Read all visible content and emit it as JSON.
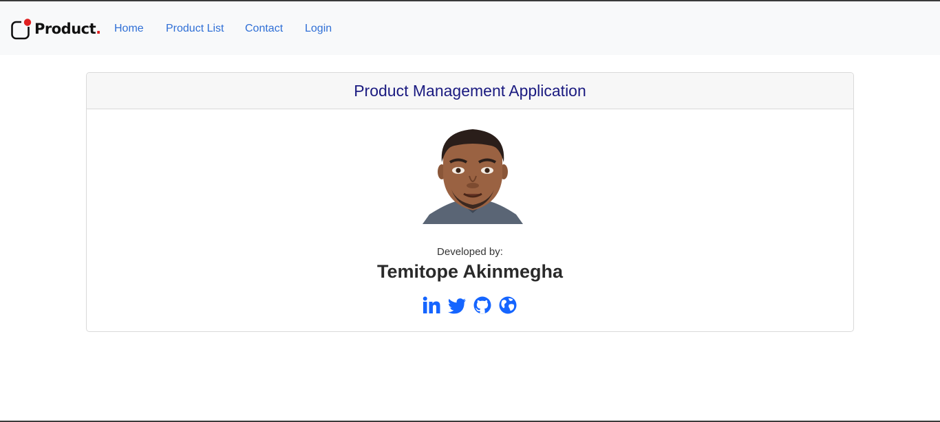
{
  "brand": {
    "name": "Product",
    "dot": "."
  },
  "nav": {
    "items": [
      {
        "label": "Home"
      },
      {
        "label": "Product List"
      },
      {
        "label": "Contact"
      },
      {
        "label": "Login"
      }
    ]
  },
  "card": {
    "title": "Product Management Application",
    "developed_by_label": "Developed by:",
    "developer_name": "Temitope Akinmegha"
  },
  "socials": [
    {
      "icon": "linkedin-icon"
    },
    {
      "icon": "twitter-icon"
    },
    {
      "icon": "github-icon"
    },
    {
      "icon": "globe-icon"
    }
  ],
  "colors": {
    "nav_link": "#2f6fd6",
    "title": "#1a1a80",
    "social": "#1565ff",
    "brand_accent": "#e02020"
  }
}
